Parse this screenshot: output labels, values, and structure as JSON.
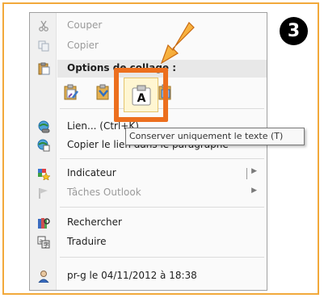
{
  "step_badge": "3",
  "menu": {
    "cut_label": "Couper",
    "copy_label": "Copier",
    "paste_options_label": "Options de collage :",
    "link_label": "Lien... (Ctrl+K)",
    "copy_link_label": "Copier le lien dans le paragraphe",
    "flag_label": "Indicateur",
    "outlook_tasks_label": "Tâches Outlook",
    "search_label": "Rechercher",
    "translate_label": "Traduire",
    "author_label": "pr-g le 04/11/2012 à 18:38"
  },
  "tooltip": "Conserver uniquement le texte (T)",
  "keep_text_glyph": "A",
  "colors": {
    "highlight": "#ec6f1e",
    "frame": "#f2a93b",
    "disabled_text": "#9a9a9a"
  }
}
